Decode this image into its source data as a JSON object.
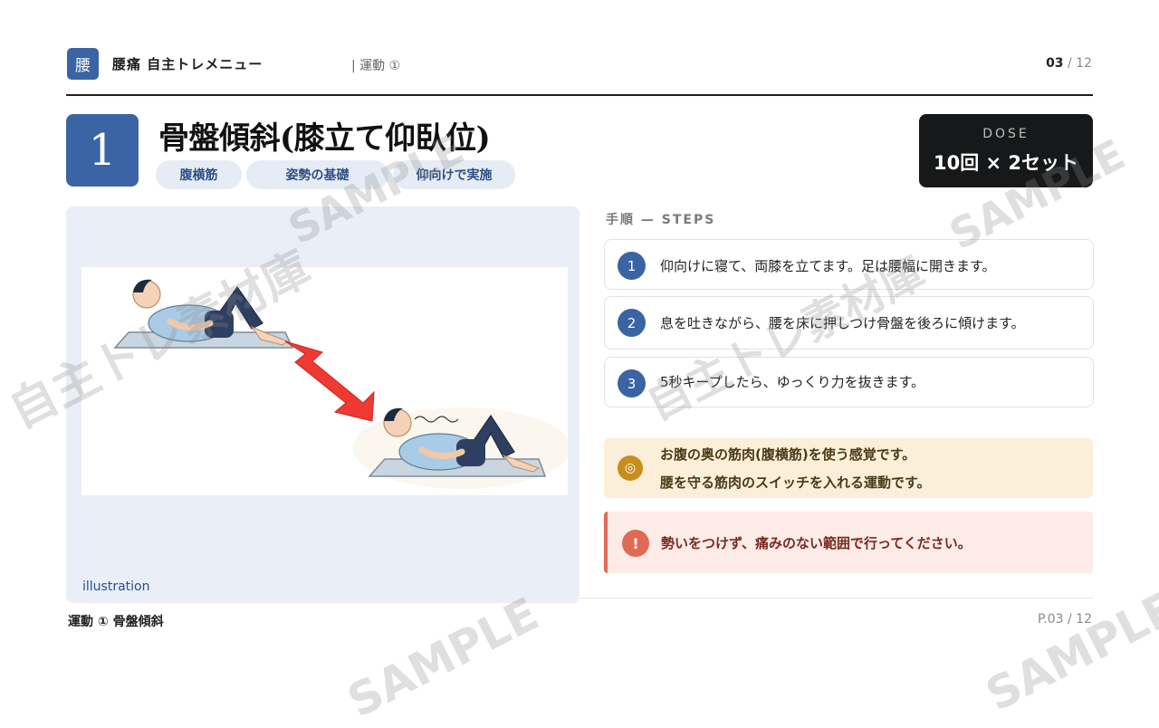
{
  "header": {
    "logo_char": "腰",
    "app_title": "腰痛 自主トレメニュー",
    "section": "| 運動 ①",
    "page_current": "03",
    "page_sep": " / ",
    "page_total": "12"
  },
  "exercise": {
    "number": "1",
    "title": "骨盤傾斜(膝立て仰臥位)",
    "tags": [
      "腹横筋",
      "姿勢の基礎",
      "仰向けで実施"
    ]
  },
  "dose": {
    "label": "DOSE",
    "value": "10回 × 2セット"
  },
  "illustration": {
    "caption": "illustration"
  },
  "steps": {
    "heading": "手順 — STEPS",
    "items": [
      {
        "num": "1",
        "text": "仰向けに寝て、両膝を立てます。足は腰幅に開きます。"
      },
      {
        "num": "2",
        "text": "息を吐きながら、腰を床に押しつけ骨盤を後ろに傾けます。"
      },
      {
        "num": "3",
        "text": "5秒キープしたら、ゆっくり力を抜きます。"
      }
    ]
  },
  "note": {
    "icon": "◎",
    "line1": "お腹の奥の筋肉(腹横筋)を使う感覚です。",
    "line2": "腰を守る筋肉のスイッチを入れる運動です。"
  },
  "warning": {
    "icon": "!",
    "text": "勢いをつけず、痛みのない範囲で行ってください。"
  },
  "footer": {
    "left": "運動 ① 骨盤傾斜",
    "right": "P.03 / 12"
  },
  "watermarks": {
    "sample": "SAMPLE",
    "brand": "自主トレ素材庫"
  },
  "colors": {
    "accent": "#3a64a3",
    "dose_bg": "#161819",
    "note_bg": "#fbefd9",
    "warning_accent": "#e16a56",
    "arrow": "#ee3a32"
  }
}
